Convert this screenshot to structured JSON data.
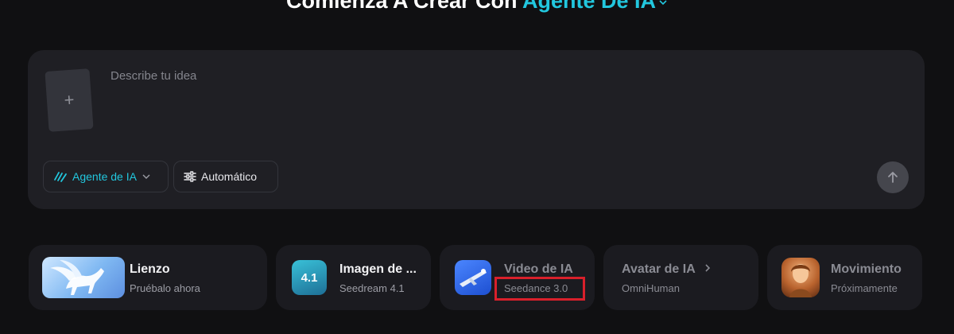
{
  "heading": {
    "prefix": "Comienza A Crear Con",
    "accent": "Agente De IA"
  },
  "prompt": {
    "placeholder": "Describe tu idea",
    "upload_symbol": "+",
    "agent_pill_label": "Agente de IA",
    "auto_pill_label": "Automático"
  },
  "features": [
    {
      "title": "Lienzo",
      "subtitle": "Pruébalo ahora"
    },
    {
      "title": "Imagen de ...",
      "subtitle": "Seedream 4.1",
      "badge": "4.1"
    },
    {
      "title": "Video de IA",
      "subtitle": "Seedance 3.0"
    },
    {
      "title": "Avatar de IA",
      "subtitle": "OmniHuman"
    },
    {
      "title": "Movimiento",
      "subtitle": "Próximamente"
    }
  ],
  "colors": {
    "accent": "#22c7de",
    "background": "#101012",
    "card": "#1f1f24",
    "highlight": "#d9202b"
  },
  "icons": [
    "chevron-down-icon",
    "plus-icon",
    "agent-wave-icon",
    "sliders-icon",
    "arrow-up-icon",
    "chevron-right-icon"
  ]
}
